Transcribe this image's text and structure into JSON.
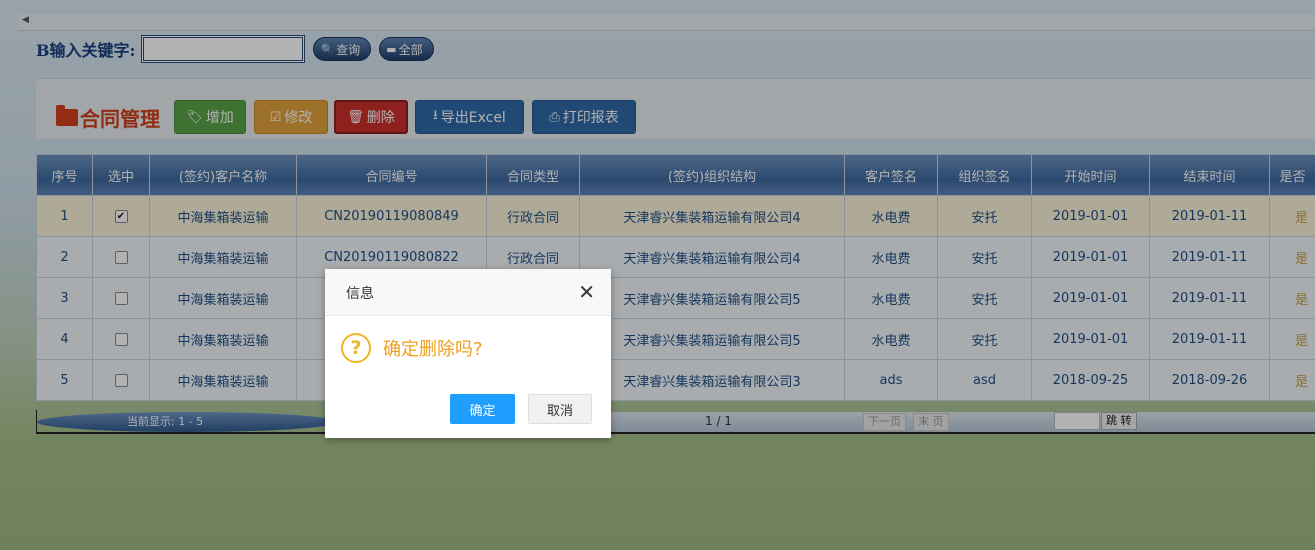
{
  "search": {
    "label": "B输入关键字:",
    "value": "",
    "query_label": "查询",
    "all_label": "全部"
  },
  "toolbar": {
    "title": "合同管理",
    "add_label": "增加",
    "edit_label": "修改",
    "delete_label": "删除",
    "export_label": "导出Excel",
    "print_label": "打印报表"
  },
  "table": {
    "headers": [
      "序号",
      "选中",
      "(签约)客户名称",
      "合同编号",
      "合同类型",
      "(签约)组织结构",
      "客户签名",
      "组织签名",
      "开始时间",
      "结束时间",
      "是否"
    ],
    "rows": [
      {
        "no": "1",
        "checked": true,
        "customer": "中海集箱装运输",
        "code": "CN20190119080849",
        "type": "行政合同",
        "org": "天津睿兴集装箱运输有限公司4",
        "cust_sign": "水电费",
        "org_sign": "安托",
        "start": "2019-01-01",
        "end": "2019-01-11",
        "last": "是"
      },
      {
        "no": "2",
        "checked": false,
        "customer": "中海集箱装运输",
        "code": "CN20190119080822",
        "type": "行政合同",
        "org": "天津睿兴集装箱运输有限公司4",
        "cust_sign": "水电费",
        "org_sign": "安托",
        "start": "2019-01-01",
        "end": "2019-01-11",
        "last": "是"
      },
      {
        "no": "3",
        "checked": false,
        "customer": "中海集箱装运输",
        "code": "",
        "type": "",
        "org": "天津睿兴集装箱运输有限公司5",
        "cust_sign": "水电费",
        "org_sign": "安托",
        "start": "2019-01-01",
        "end": "2019-01-11",
        "last": "是"
      },
      {
        "no": "4",
        "checked": false,
        "customer": "中海集箱装运输",
        "code": "",
        "type": "",
        "org": "天津睿兴集装箱运输有限公司5",
        "cust_sign": "水电费",
        "org_sign": "安托",
        "start": "2019-01-01",
        "end": "2019-01-11",
        "last": "是"
      },
      {
        "no": "5",
        "checked": false,
        "customer": "中海集箱装运输",
        "code": "",
        "type": "",
        "org": "天津睿兴集装箱运输有限公司3",
        "cust_sign": "ads",
        "org_sign": "asd",
        "start": "2018-09-25",
        "end": "2018-09-26",
        "last": "是"
      }
    ]
  },
  "pager": {
    "shown": "当前显示: 1 - 5",
    "page": "1 / 1",
    "next": "下一页",
    "last": "末 页",
    "jump_label": "跳 转"
  },
  "dialog": {
    "title": "信息",
    "message": "确定删除吗?",
    "ok_label": "确定",
    "cancel_label": "取消"
  },
  "colors": {
    "dialog_accent": "#f0a01e",
    "ok_button": "#1e9fff",
    "header_blue": "#3f6aa0",
    "delete_red": "#c9302c"
  }
}
